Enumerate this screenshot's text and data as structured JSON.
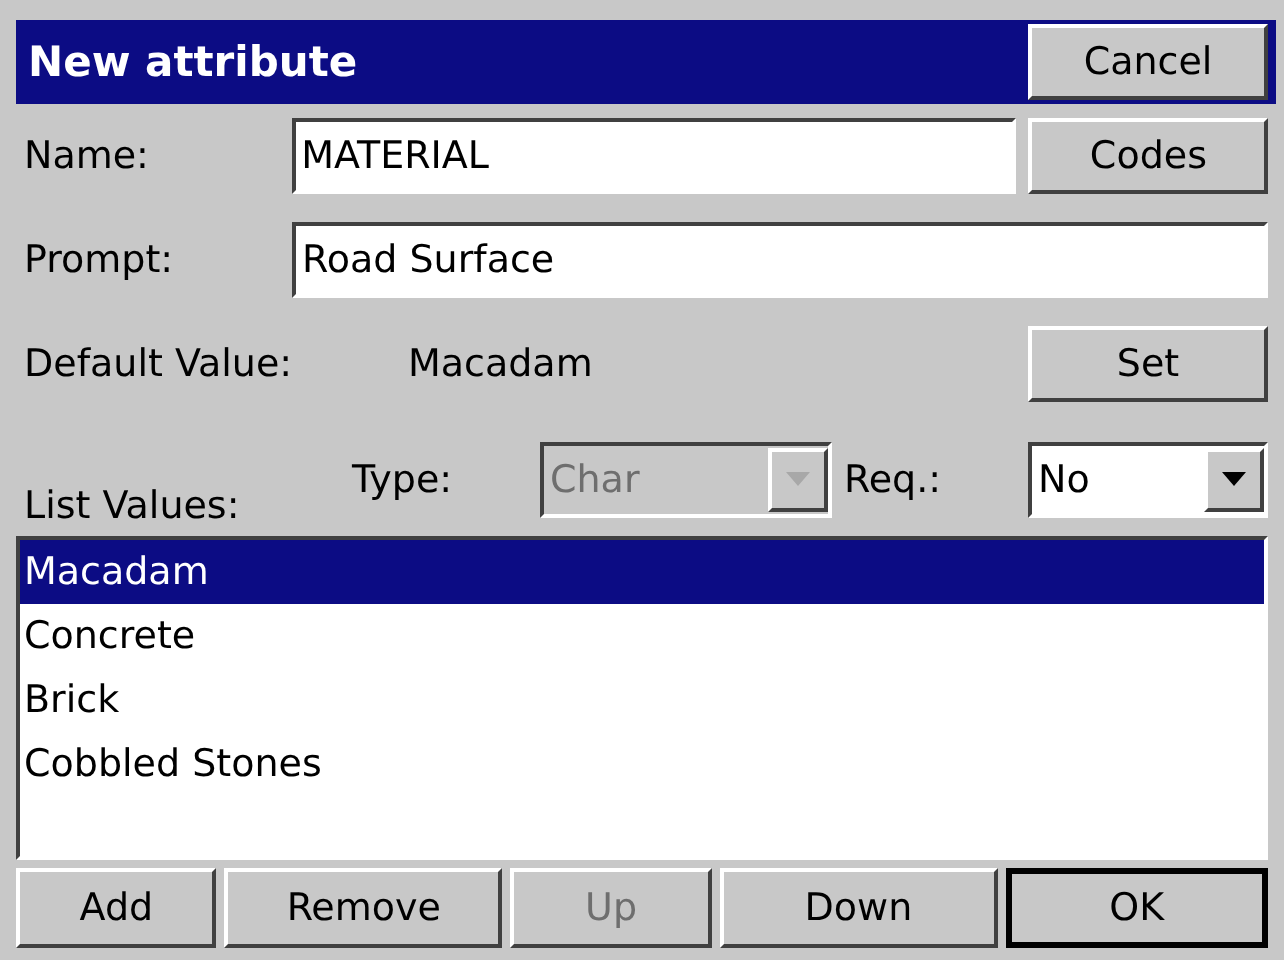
{
  "window": {
    "title": "New attribute"
  },
  "cancel_button": {
    "label": "Cancel"
  },
  "name": {
    "label": "Name:",
    "value": "MATERIAL"
  },
  "codes_button": {
    "label": "Codes"
  },
  "prompt": {
    "label": "Prompt:",
    "value": "Road Surface"
  },
  "default_value": {
    "label": "Default Value:",
    "value": "Macadam"
  },
  "set_button": {
    "label": "Set"
  },
  "list_values": {
    "label": "List Values:"
  },
  "type": {
    "label": "Type:",
    "value": "Char",
    "disabled": true
  },
  "required": {
    "label": "Req.:",
    "value": "No",
    "disabled": false
  },
  "list": [
    {
      "text": "Macadam",
      "selected": true
    },
    {
      "text": "Concrete",
      "selected": false
    },
    {
      "text": "Brick",
      "selected": false
    },
    {
      "text": "Cobbled Stones",
      "selected": false
    }
  ],
  "buttons": [
    {
      "label": "Add",
      "disabled": false,
      "default": false
    },
    {
      "label": "Remove",
      "disabled": false,
      "default": false
    },
    {
      "label": "Up",
      "disabled": true,
      "default": false
    },
    {
      "label": "Down",
      "disabled": false,
      "default": false
    },
    {
      "label": "OK",
      "disabled": false,
      "default": true
    }
  ]
}
